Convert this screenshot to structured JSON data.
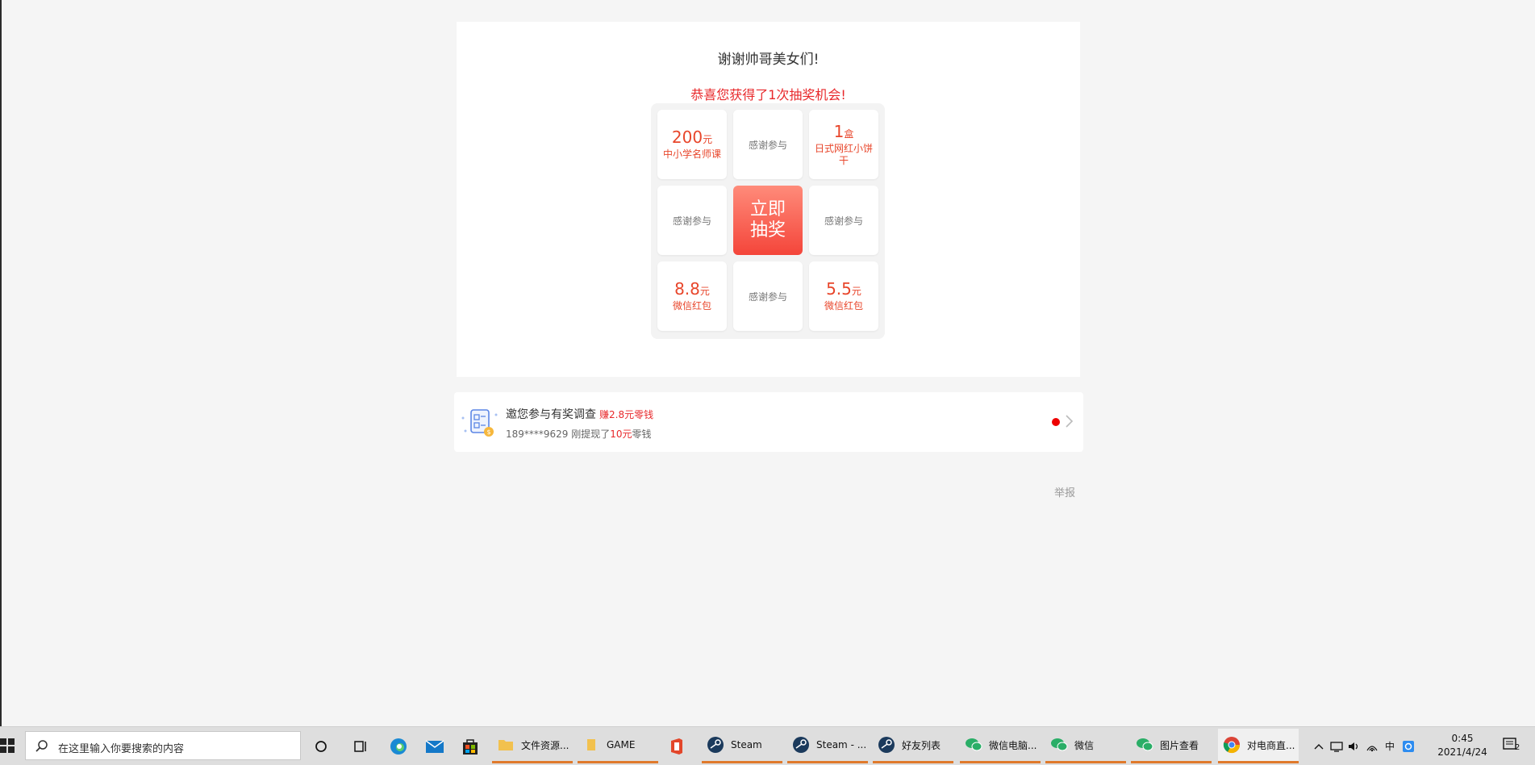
{
  "lottery": {
    "thanks_text": "谢谢帅哥美女们!",
    "congrats_text": "恭喜您获得了1次抽奖机会!",
    "draw_button": "立即抽奖",
    "prizes": [
      {
        "amount": "200",
        "unit": "元",
        "desc": "中小学名师课"
      },
      {
        "text": "感谢参与"
      },
      {
        "amount": "1",
        "unit": "盒",
        "desc": "日式网红小饼干"
      },
      {
        "text": "感谢参与"
      },
      {
        "text": "感谢参与"
      },
      {
        "amount": "8.8",
        "unit": "元",
        "desc": "微信红包"
      },
      {
        "text": "感谢参与"
      },
      {
        "amount": "5.5",
        "unit": "元",
        "desc": "微信红包"
      }
    ]
  },
  "survey": {
    "title": "邀您参与有奖调查",
    "bonus": "赚2.8元零钱",
    "sub_prefix": "189****9629 刚提现了",
    "sub_money": "10元",
    "sub_suffix": "零钱"
  },
  "report_link": "举报",
  "taskbar": {
    "search_placeholder": "在这里输入你要搜索的内容",
    "apps": [
      {
        "label": "文件资源..."
      },
      {
        "label": "GAME"
      },
      {
        "label": "Steam"
      },
      {
        "label": "Steam - ..."
      },
      {
        "label": "好友列表"
      },
      {
        "label": "微信电脑..."
      },
      {
        "label": "微信"
      },
      {
        "label": "图片查看"
      },
      {
        "label": "对电商直..."
      }
    ],
    "ime": "中",
    "time": "0:45",
    "date": "2021/4/24",
    "notification_count": "2"
  },
  "colors": {
    "accent_red": "#e8282b",
    "prize_orange": "#e8462b",
    "button_red": "#f4453a",
    "taskbar_underline": "#e07a2c"
  }
}
